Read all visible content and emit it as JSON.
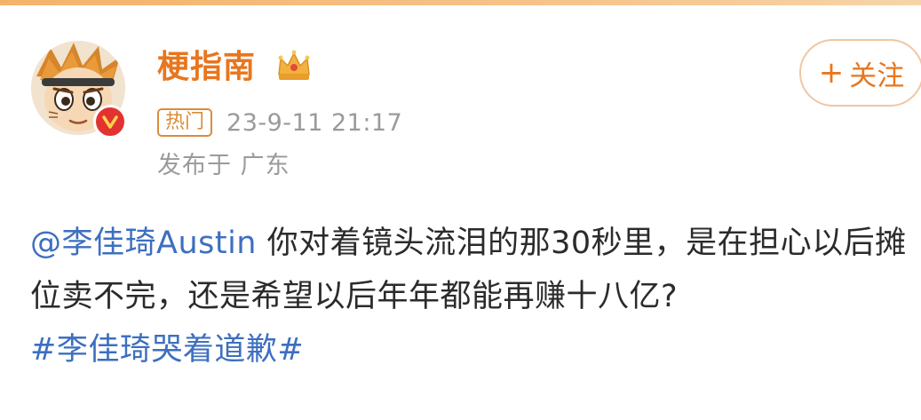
{
  "post": {
    "author": {
      "name": "梗指南",
      "avatar_icon": "cartoon-avatar-icon",
      "verified_icon": "verified-badge-icon",
      "crown_icon": "crown-icon"
    },
    "hot_label": "热门",
    "timestamp": "23-9-11 21:17",
    "location": "发布于 广东",
    "follow": {
      "plus": "+",
      "label": "关注"
    },
    "body": {
      "mention": "@李佳琦Austin",
      "text": " 你对着镜头流泪的那30秒里，是在担心以后摊位卖不完，还是希望以后年年都能再赚十八亿?",
      "hashtag": "#李佳琦哭着道歉#"
    }
  },
  "colors": {
    "accent_orange": "#e8761e",
    "link_blue": "#3d6fc0",
    "meta_gray": "#9a9a9a",
    "verified_red": "#e33232"
  }
}
